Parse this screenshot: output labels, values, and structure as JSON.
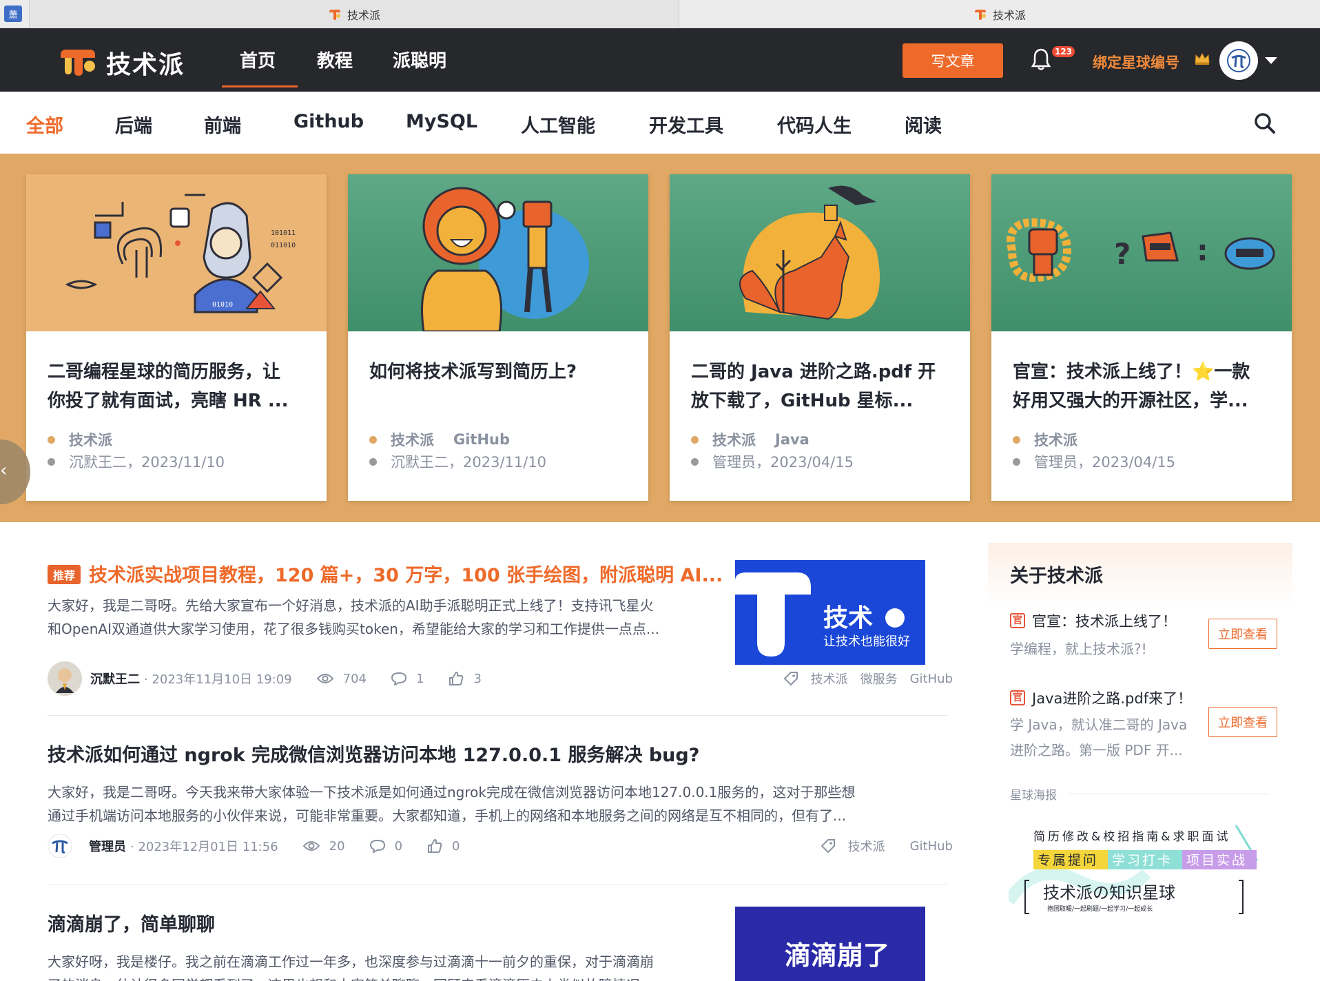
{
  "browser": {
    "pinned_tab": "萧",
    "tabs": [
      {
        "title": "技术派"
      },
      {
        "title": "技术派"
      }
    ]
  },
  "header": {
    "logo_text": "技术派",
    "nav": [
      "首页",
      "教程",
      "派聪明"
    ],
    "active_nav": "首页",
    "write_button": "写文章",
    "notification_count": "123",
    "bind_link": "绑定星球编号"
  },
  "categories": {
    "items": [
      "全部",
      "后端",
      "前端",
      "Github",
      "MySQL",
      "人工智能",
      "开发工具",
      "代码人生",
      "阅读"
    ],
    "active": "全部"
  },
  "banner_cards": [
    {
      "title_line1": "二哥编程星球的简历服务，让",
      "title_line2": "你投了就有面试，亮瞎 HR ...",
      "tag1": "技术派",
      "tag2": "",
      "author_date": "沉默王二，2023/11/10"
    },
    {
      "title_line1": "如何将技术派写到简历上?",
      "title_line2": "",
      "tag1": "技术派",
      "tag2": "GitHub",
      "author_date": "沉默王二，2023/11/10"
    },
    {
      "title_line1": "二哥的 Java 进阶之路.pdf 开",
      "title_line2": "放下载了，GitHub 星标...",
      "tag1": "技术派",
      "tag2": "Java",
      "author_date": "管理员，2023/04/15"
    },
    {
      "title_line1": "官宣：技术派上线了！⭐一款",
      "title_line2": "好用又强大的开源社区，学...",
      "tag1": "技术派",
      "tag2": "",
      "author_date": "管理员，2023/04/15"
    }
  ],
  "articles": [
    {
      "badge": "推荐",
      "title": "技术派实战项目教程，120 篇+，30 万字，100 张手绘图，附派聪明 AI...",
      "summary_line1": "大家好，我是二哥呀。先给大家宣布一个好消息，技术派的AI助手派聪明正式上线了！支持讯飞星火",
      "summary_line2": "和OpenAI双通道供大家学习使用，花了很多钱购买token，希望能给大家的学习和工作提供一点点...",
      "author": "沉默王二",
      "date": "· 2023年11月10日 19:09",
      "views": "704",
      "comments": "1",
      "likes": "3",
      "tags": [
        "技术派",
        "微服务",
        "GitHub"
      ],
      "thumb_text1": "技术",
      "thumb_text2": "让技术也能很好"
    },
    {
      "title": "技术派如何通过 ngrok 完成微信浏览器访问本地 127.0.0.1 服务解决 bug?",
      "summary_line1": "大家好，我是二哥呀。今天我来带大家体验一下技术派是如何通过ngrok完成在微信浏览器访问本地127.0.0.1服务的，这对于那些想",
      "summary_line2": "通过手机端访问本地服务的小伙伴来说，可能非常重要。大家都知道，手机上的网络和本地服务之间的网络是互不相同的，但有了...",
      "author": "管理员",
      "date": "· 2023年12月01日 11:56",
      "views": "20",
      "comments": "0",
      "likes": "0",
      "tags": [
        "技术派",
        "GitHub"
      ]
    },
    {
      "title": "滴滴崩了，简单聊聊",
      "summary_line1": "大家好呀，我是楼仔。我之前在滴滴工作过一年多，也深度参与过滴滴十一前夕的重保，对于滴滴崩",
      "summary_line2": "了的消息，估计很多同学都看到了，这里也想和大家简单聊聊，回顾来看滴滴历史上类似故障情况...",
      "thumb_text": "滴滴崩了"
    }
  ],
  "sidebar": {
    "title": "关于技术派",
    "items": [
      {
        "badge": "官",
        "title": "官宣：技术派上线了！",
        "desc_line1": "学编程，就上技术派?!",
        "desc_line2": "",
        "button": "立即查看"
      },
      {
        "badge": "官",
        "title": "Java进阶之路.pdf来了！",
        "desc_line1": "学 Java，就认准二哥的 Java",
        "desc_line2": "进阶之路。第一版 PDF 开...",
        "button": "立即查看"
      }
    ],
    "poster_label": "星球海报",
    "poster": {
      "line1": "简历修改&校招指南&求职面试",
      "chip1": "专属提问",
      "chip2": "学习打卡",
      "chip3": "项目实战",
      "main": "技术派の知识星球",
      "sub": "抱团取暖/一起刷题/一起学习/一起成长"
    }
  },
  "colors": {
    "accent": "#ee6a2a",
    "header_bg": "#27282c",
    "banner_bg": "#e0a864"
  }
}
